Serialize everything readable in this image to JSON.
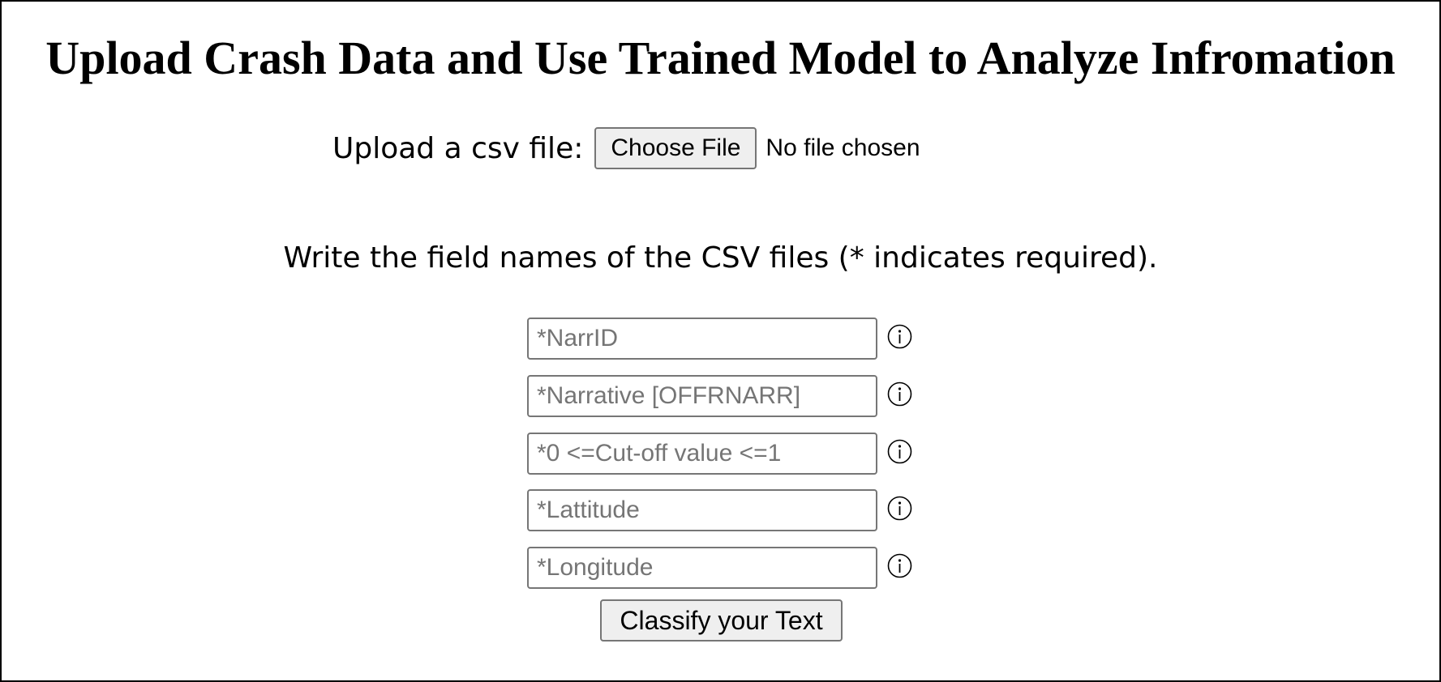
{
  "page": {
    "title": "Upload Crash Data and Use Trained Model to Analyze Infromation"
  },
  "upload": {
    "label": "Upload a csv file:",
    "button_label": "Choose File",
    "status": "No file chosen"
  },
  "instructions": "Write the field names of the CSV files (* indicates required).",
  "fields": [
    {
      "placeholder": "*NarrID",
      "value": "",
      "icon": "info-icon"
    },
    {
      "placeholder": "*Narrative [OFFRNARR]",
      "value": "",
      "icon": "info-icon"
    },
    {
      "placeholder": "*0 <=Cut-off value <=1",
      "value": "",
      "icon": "info-icon"
    },
    {
      "placeholder": "*Lattitude",
      "value": "",
      "icon": "info-icon"
    },
    {
      "placeholder": "*Longitude",
      "value": "",
      "icon": "info-icon"
    }
  ],
  "submit": {
    "label": "Classify your Text"
  }
}
